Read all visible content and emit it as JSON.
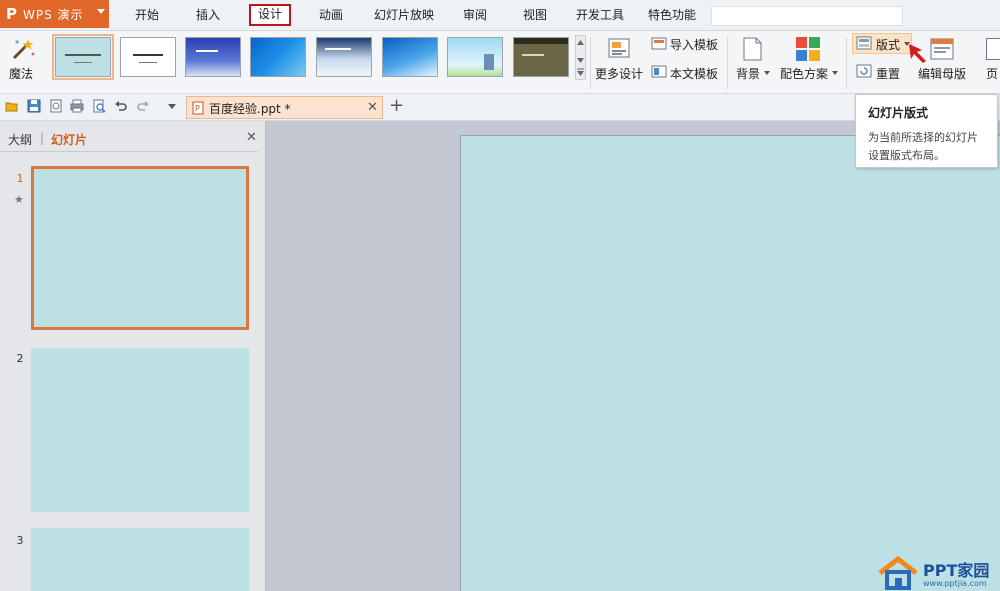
{
  "app": {
    "name": "WPS 演示",
    "logo": "P"
  },
  "menu": {
    "tabs": [
      "开始",
      "插入",
      "设计",
      "动画",
      "幻灯片放映",
      "审阅",
      "视图",
      "开发工具",
      "特色功能"
    ],
    "active_tab": "设计"
  },
  "ribbon": {
    "magic_label": "魔法",
    "more_design_label": "更多设计",
    "import_template_label": "导入模板",
    "this_template_label": "本文模板",
    "background_label": "背景",
    "color_scheme_label": "配色方案",
    "layout_label": "版式",
    "reset_label": "重置",
    "edit_master_label": "编辑母版",
    "page_label": "页"
  },
  "document": {
    "tab_title": "百度经验.ppt *"
  },
  "left_panel": {
    "outline_tab": "大纲",
    "slides_tab": "幻灯片",
    "slide_numbers": [
      "1",
      "2",
      "3"
    ]
  },
  "tooltip": {
    "title": "幻灯片版式",
    "desc_line1": "为当前所选择的幻灯片",
    "desc_line2": "设置版式布局。"
  },
  "watermark": {
    "site": "www.pptjia.com"
  },
  "colors": {
    "accent": "#e0662a",
    "active_tab_border": "#c0141b",
    "slide_bg": "#bde0e4"
  }
}
